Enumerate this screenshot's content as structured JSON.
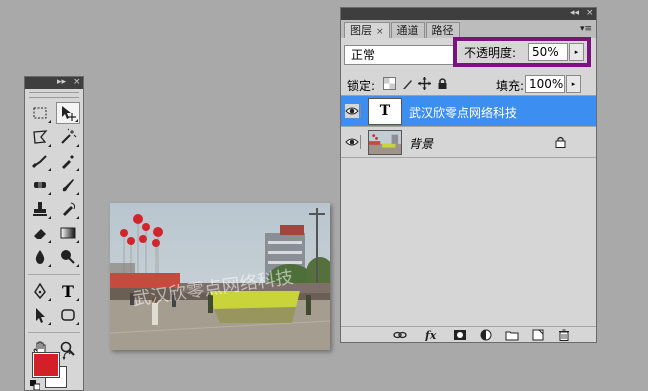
{
  "tools_panel": {
    "collapse_glyph": "▸▸",
    "close_glyph": "×",
    "tools": [
      [
        "rect-marquee",
        "move"
      ],
      [
        "lasso",
        "magic-wand"
      ],
      [
        "crop",
        "eyedropper"
      ],
      [
        "healing",
        "brush"
      ],
      [
        "stamp",
        "history-brush"
      ],
      [
        "eraser",
        "gradient"
      ],
      [
        "blur",
        "dodge"
      ],
      [
        "pen",
        "type"
      ],
      [
        "path-select",
        "shape"
      ],
      [
        "hand",
        "zoom"
      ]
    ],
    "type_tool_glyph": "T",
    "foreground_color": "#d32027",
    "background_color": "#ffffff"
  },
  "layers_panel": {
    "collapse_glyph": "◂◂",
    "close_glyph": "×",
    "tabs": [
      {
        "label": "图层",
        "active": true
      },
      {
        "label": "通道",
        "active": false
      },
      {
        "label": "路径",
        "active": false
      }
    ],
    "tab_close_glyph": "×",
    "menu_glyph": "▾≡",
    "blend_mode": "正常",
    "opacity_label": "不透明度:",
    "opacity_value": "50%",
    "opacity_highlight_color": "#7a137e",
    "lock_label": "锁定:",
    "fill_label": "填充:",
    "fill_value": "100%",
    "stepper_glyph": "▸",
    "layers": [
      {
        "name": "武汉欣零点网络科技",
        "type": "text",
        "thumb_glyph": "T",
        "selected": true
      },
      {
        "name": "背景",
        "type": "image",
        "selected": false,
        "locked": true
      }
    ],
    "selection_color": "#3c8ef0"
  },
  "document": {
    "watermark_text": "武汉欣零点网络科技"
  }
}
